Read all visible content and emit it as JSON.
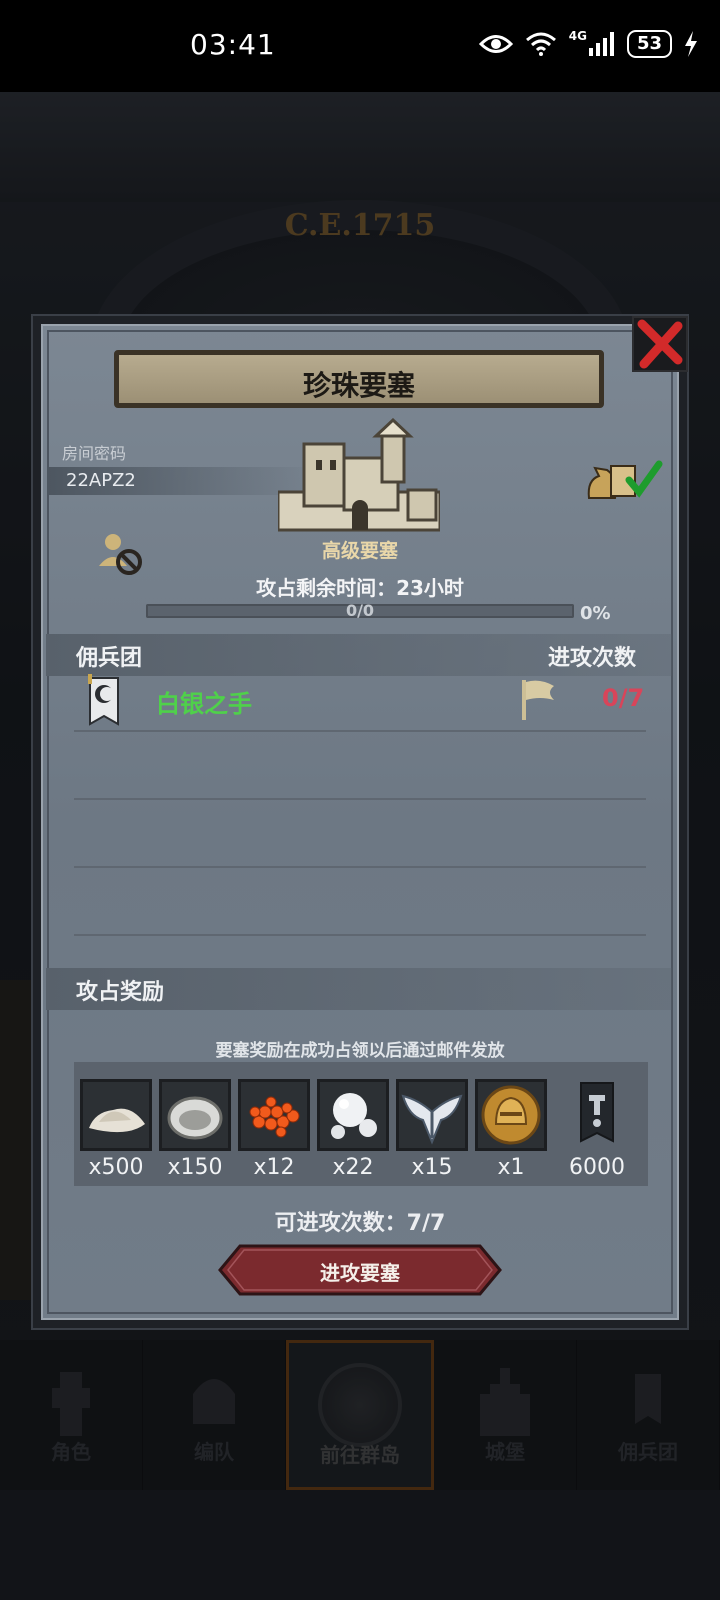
{
  "status_bar": {
    "time": "03:41",
    "network": "4G",
    "battery": "53"
  },
  "background": {
    "era": "C.E.1715"
  },
  "bottom_nav": [
    {
      "label": "角色"
    },
    {
      "label": "编队"
    },
    {
      "label": "前往群岛",
      "active": true
    },
    {
      "label": "城堡"
    },
    {
      "label": "佣兵团"
    }
  ],
  "modal": {
    "title": "珍珠要塞",
    "room_label": "房间密码",
    "room_code": "22APZ2",
    "fort_type": "高级要塞",
    "remaining_time": "攻占剩余时间：23小时",
    "progress": {
      "text": "0/0",
      "percent_text": "0%",
      "value": 0
    },
    "mercenary_header": "佣兵团",
    "attacks_header": "进攻次数",
    "mercenaries": [
      {
        "name": "白银之手",
        "attacks": "0/7"
      }
    ],
    "reward_header": "攻占奖励",
    "reward_note": "要塞奖励在成功占领以后通过邮件发放",
    "rewards": [
      {
        "icon": "salt-icon",
        "qty": "x500"
      },
      {
        "icon": "oyster-icon",
        "qty": "x150"
      },
      {
        "icon": "roe-icon",
        "qty": "x12"
      },
      {
        "icon": "pearl-icon",
        "qty": "x22"
      },
      {
        "icon": "winged-emblem-icon",
        "qty": "x15"
      },
      {
        "icon": "helmet-coin-icon",
        "qty": "x1"
      },
      {
        "icon": "guild-banner-icon",
        "qty": "6000"
      }
    ],
    "attack_count": "可进攻次数：7/7",
    "attack_button": "进攻要塞"
  },
  "colors": {
    "green_name": "#4fd14a",
    "red_count": "#d8455a",
    "gold_text": "#e9d7a9",
    "button_red": "#7b2a2e"
  }
}
